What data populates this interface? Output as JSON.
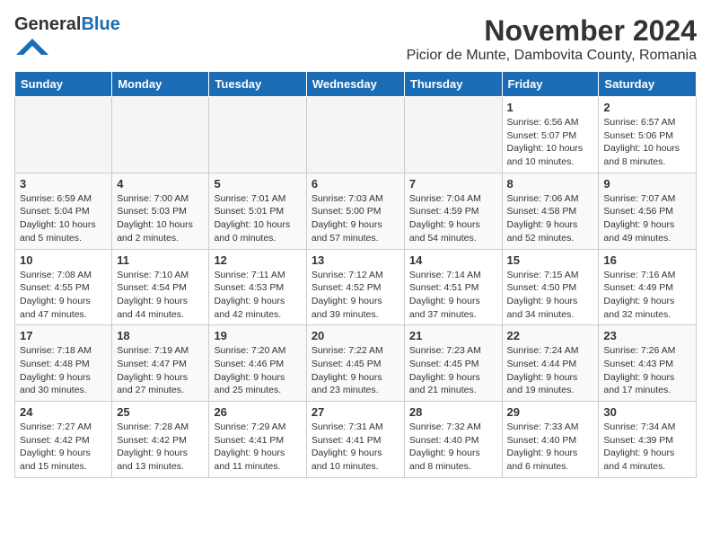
{
  "header": {
    "logo_general": "General",
    "logo_blue": "Blue",
    "month_title": "November 2024",
    "location": "Picior de Munte, Dambovita County, Romania"
  },
  "calendar": {
    "days_of_week": [
      "Sunday",
      "Monday",
      "Tuesday",
      "Wednesday",
      "Thursday",
      "Friday",
      "Saturday"
    ],
    "weeks": [
      [
        {
          "day": "",
          "info": ""
        },
        {
          "day": "",
          "info": ""
        },
        {
          "day": "",
          "info": ""
        },
        {
          "day": "",
          "info": ""
        },
        {
          "day": "",
          "info": ""
        },
        {
          "day": "1",
          "info": "Sunrise: 6:56 AM\nSunset: 5:07 PM\nDaylight: 10 hours\nand 10 minutes."
        },
        {
          "day": "2",
          "info": "Sunrise: 6:57 AM\nSunset: 5:06 PM\nDaylight: 10 hours\nand 8 minutes."
        }
      ],
      [
        {
          "day": "3",
          "info": "Sunrise: 6:59 AM\nSunset: 5:04 PM\nDaylight: 10 hours\nand 5 minutes."
        },
        {
          "day": "4",
          "info": "Sunrise: 7:00 AM\nSunset: 5:03 PM\nDaylight: 10 hours\nand 2 minutes."
        },
        {
          "day": "5",
          "info": "Sunrise: 7:01 AM\nSunset: 5:01 PM\nDaylight: 10 hours\nand 0 minutes."
        },
        {
          "day": "6",
          "info": "Sunrise: 7:03 AM\nSunset: 5:00 PM\nDaylight: 9 hours\nand 57 minutes."
        },
        {
          "day": "7",
          "info": "Sunrise: 7:04 AM\nSunset: 4:59 PM\nDaylight: 9 hours\nand 54 minutes."
        },
        {
          "day": "8",
          "info": "Sunrise: 7:06 AM\nSunset: 4:58 PM\nDaylight: 9 hours\nand 52 minutes."
        },
        {
          "day": "9",
          "info": "Sunrise: 7:07 AM\nSunset: 4:56 PM\nDaylight: 9 hours\nand 49 minutes."
        }
      ],
      [
        {
          "day": "10",
          "info": "Sunrise: 7:08 AM\nSunset: 4:55 PM\nDaylight: 9 hours\nand 47 minutes."
        },
        {
          "day": "11",
          "info": "Sunrise: 7:10 AM\nSunset: 4:54 PM\nDaylight: 9 hours\nand 44 minutes."
        },
        {
          "day": "12",
          "info": "Sunrise: 7:11 AM\nSunset: 4:53 PM\nDaylight: 9 hours\nand 42 minutes."
        },
        {
          "day": "13",
          "info": "Sunrise: 7:12 AM\nSunset: 4:52 PM\nDaylight: 9 hours\nand 39 minutes."
        },
        {
          "day": "14",
          "info": "Sunrise: 7:14 AM\nSunset: 4:51 PM\nDaylight: 9 hours\nand 37 minutes."
        },
        {
          "day": "15",
          "info": "Sunrise: 7:15 AM\nSunset: 4:50 PM\nDaylight: 9 hours\nand 34 minutes."
        },
        {
          "day": "16",
          "info": "Sunrise: 7:16 AM\nSunset: 4:49 PM\nDaylight: 9 hours\nand 32 minutes."
        }
      ],
      [
        {
          "day": "17",
          "info": "Sunrise: 7:18 AM\nSunset: 4:48 PM\nDaylight: 9 hours\nand 30 minutes."
        },
        {
          "day": "18",
          "info": "Sunrise: 7:19 AM\nSunset: 4:47 PM\nDaylight: 9 hours\nand 27 minutes."
        },
        {
          "day": "19",
          "info": "Sunrise: 7:20 AM\nSunset: 4:46 PM\nDaylight: 9 hours\nand 25 minutes."
        },
        {
          "day": "20",
          "info": "Sunrise: 7:22 AM\nSunset: 4:45 PM\nDaylight: 9 hours\nand 23 minutes."
        },
        {
          "day": "21",
          "info": "Sunrise: 7:23 AM\nSunset: 4:45 PM\nDaylight: 9 hours\nand 21 minutes."
        },
        {
          "day": "22",
          "info": "Sunrise: 7:24 AM\nSunset: 4:44 PM\nDaylight: 9 hours\nand 19 minutes."
        },
        {
          "day": "23",
          "info": "Sunrise: 7:26 AM\nSunset: 4:43 PM\nDaylight: 9 hours\nand 17 minutes."
        }
      ],
      [
        {
          "day": "24",
          "info": "Sunrise: 7:27 AM\nSunset: 4:42 PM\nDaylight: 9 hours\nand 15 minutes."
        },
        {
          "day": "25",
          "info": "Sunrise: 7:28 AM\nSunset: 4:42 PM\nDaylight: 9 hours\nand 13 minutes."
        },
        {
          "day": "26",
          "info": "Sunrise: 7:29 AM\nSunset: 4:41 PM\nDaylight: 9 hours\nand 11 minutes."
        },
        {
          "day": "27",
          "info": "Sunrise: 7:31 AM\nSunset: 4:41 PM\nDaylight: 9 hours\nand 10 minutes."
        },
        {
          "day": "28",
          "info": "Sunrise: 7:32 AM\nSunset: 4:40 PM\nDaylight: 9 hours\nand 8 minutes."
        },
        {
          "day": "29",
          "info": "Sunrise: 7:33 AM\nSunset: 4:40 PM\nDaylight: 9 hours\nand 6 minutes."
        },
        {
          "day": "30",
          "info": "Sunrise: 7:34 AM\nSunset: 4:39 PM\nDaylight: 9 hours\nand 4 minutes."
        }
      ]
    ]
  }
}
